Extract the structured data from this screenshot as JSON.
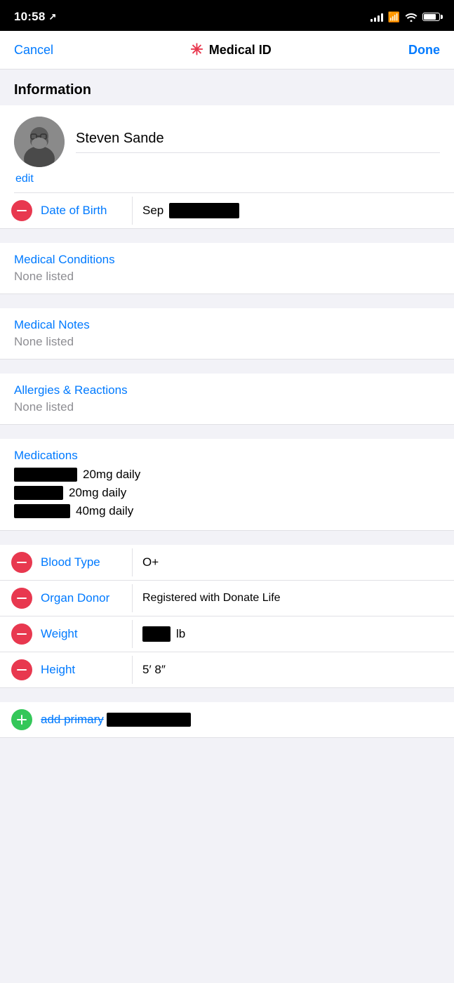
{
  "statusBar": {
    "time": "10:58",
    "locationIcon": "↗"
  },
  "navBar": {
    "cancel": "Cancel",
    "title": "Medical ID",
    "done": "Done"
  },
  "sectionHeader": "Information",
  "profile": {
    "name": "Steven Sande",
    "editLabel": "edit"
  },
  "fields": {
    "dateOfBirth": {
      "label": "Date of Birth",
      "month": "Sep"
    },
    "medicalConditions": {
      "label": "Medical Conditions",
      "value": "None listed"
    },
    "medicalNotes": {
      "label": "Medical Notes",
      "value": "None listed"
    },
    "allergies": {
      "label": "Allergies & Reactions",
      "value": "None listed"
    },
    "medications": {
      "label": "Medications",
      "items": [
        {
          "dose": "20mg daily",
          "nameWidth": "90"
        },
        {
          "dose": "20mg daily",
          "nameWidth": "70"
        },
        {
          "dose": "40mg daily",
          "nameWidth": "80"
        }
      ]
    },
    "bloodType": {
      "label": "Blood Type",
      "value": "O+"
    },
    "organDonor": {
      "label": "Organ Donor",
      "value": "Registered with Donate Life"
    },
    "weight": {
      "label": "Weight",
      "unit": "lb"
    },
    "height": {
      "label": "Height",
      "value": "5′ 8″"
    }
  },
  "addRow": {
    "label": "add primary language"
  }
}
